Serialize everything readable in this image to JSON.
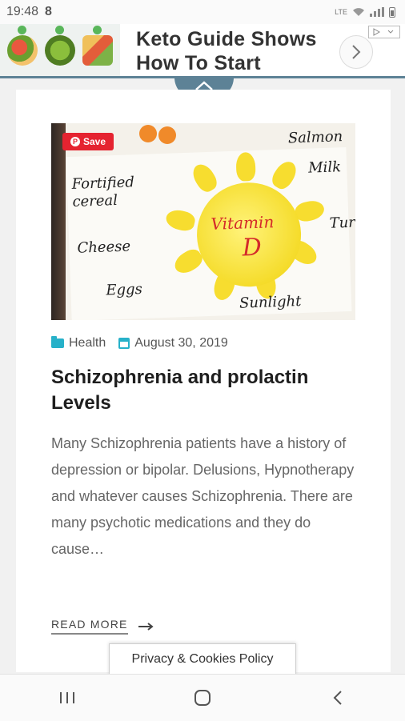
{
  "status_bar": {
    "time": "19:48",
    "carrier_icon": "8",
    "network_label": "LTE"
  },
  "ad": {
    "headline": "Keto Guide Shows How To Start",
    "next_icon": "chevron-right-icon",
    "adchoices_icon": "adchoices-icon"
  },
  "post": {
    "image": {
      "pin_save_label": "Save",
      "sun_title": "Vitamin",
      "sun_letter": "D",
      "words": [
        "Fortified cereal",
        "Cheese",
        "Eggs",
        "Sunlight",
        "Salmon",
        "Milk",
        "Tur"
      ]
    },
    "category": "Health",
    "date": "August 30, 2019",
    "title": "Schizophrenia and prolactin Levels",
    "excerpt": "Many Schizophrenia patients have a history of depression or bipolar. Delusions, Hypnotherapy and whatever causes Schizophrenia. There are many psychotic medications and they do cause…",
    "read_more": "READ MORE"
  },
  "cookie_banner": {
    "label": "Privacy & Cookies Policy"
  },
  "nav": {
    "recents_icon": "recents-icon",
    "home_icon": "home-icon",
    "back_icon": "back-icon"
  },
  "colors": {
    "accent": "#27b1c9",
    "ad_border": "#5d8296",
    "pinterest": "#e52330"
  }
}
